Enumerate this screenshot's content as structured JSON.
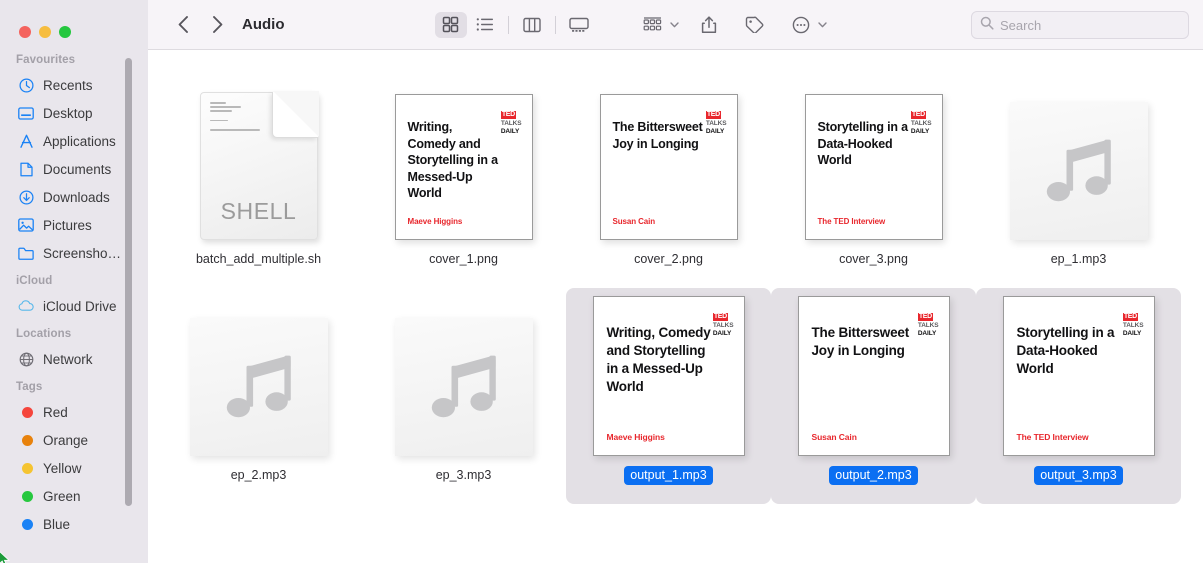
{
  "window": {
    "title": "Audio",
    "traffic_lights": [
      "close",
      "minimize",
      "zoom"
    ]
  },
  "toolbar": {
    "back_label": "Back",
    "forward_label": "Forward",
    "views": [
      {
        "name": "icon-view",
        "label": "Icon View",
        "active": true
      },
      {
        "name": "list-view",
        "label": "List View",
        "active": false
      },
      {
        "name": "column-view",
        "label": "Column View",
        "active": false
      },
      {
        "name": "gallery-view",
        "label": "Gallery View",
        "active": false
      }
    ],
    "group_label": "Group Items",
    "share_label": "Share",
    "tag_label": "Tags",
    "more_label": "More"
  },
  "search": {
    "placeholder": "Search",
    "value": ""
  },
  "sidebar": {
    "sections": [
      {
        "title": "Favourites",
        "items": [
          {
            "label": "Recents",
            "icon": "clock-icon"
          },
          {
            "label": "Desktop",
            "icon": "desktop-icon"
          },
          {
            "label": "Applications",
            "icon": "applications-icon"
          },
          {
            "label": "Documents",
            "icon": "document-icon"
          },
          {
            "label": "Downloads",
            "icon": "download-icon"
          },
          {
            "label": "Pictures",
            "icon": "pictures-icon"
          },
          {
            "label": "Screensho…",
            "icon": "folder-icon"
          }
        ]
      },
      {
        "title": "iCloud",
        "items": [
          {
            "label": "iCloud Drive",
            "icon": "cloud-icon"
          }
        ]
      },
      {
        "title": "Locations",
        "items": [
          {
            "label": "Network",
            "icon": "globe-icon"
          }
        ]
      },
      {
        "title": "Tags",
        "items": [
          {
            "label": "Red",
            "icon": "tag-dot",
            "color": "#f5453c"
          },
          {
            "label": "Orange",
            "icon": "tag-dot",
            "color": "#e8820c"
          },
          {
            "label": "Yellow",
            "icon": "tag-dot",
            "color": "#f5c game"
          },
          {
            "label": "Green",
            "icon": "tag-dot",
            "color": "#27c83f"
          },
          {
            "label": "Blue",
            "icon": "tag-dot",
            "color": "#1a82f5"
          }
        ]
      }
    ]
  },
  "files": [
    {
      "name": "batch_add_multiple.sh",
      "kind": "shell-script",
      "kind_label": "SHELL",
      "selected": false
    },
    {
      "name": "cover_1.png",
      "kind": "image-cover",
      "selected": false,
      "cover": {
        "title": "Writing, Comedy and Storytelling in a Messed-Up World",
        "author": "Maeve Higgins",
        "logo": {
          "line1": "TED",
          "line2": "TALKS",
          "line3": "DAILY"
        }
      }
    },
    {
      "name": "cover_2.png",
      "kind": "image-cover",
      "selected": false,
      "cover": {
        "title": "The Bittersweet Joy in Longing",
        "author": "Susan Cain",
        "logo": {
          "line1": "TED",
          "line2": "TALKS",
          "line3": "DAILY"
        }
      }
    },
    {
      "name": "cover_3.png",
      "kind": "image-cover",
      "selected": false,
      "cover": {
        "title": "Storytelling in a Data-Hooked World",
        "author": "The TED Interview",
        "logo": {
          "line1": "TED",
          "line2": "TALKS",
          "line3": "DAILY"
        }
      }
    },
    {
      "name": "ep_1.mp3",
      "kind": "audio",
      "selected": false
    },
    {
      "name": "ep_2.mp3",
      "kind": "audio",
      "selected": false
    },
    {
      "name": "ep_3.mp3",
      "kind": "audio",
      "selected": false
    },
    {
      "name": "output_1.mp3",
      "kind": "audio-cover",
      "selected": true,
      "cover": {
        "title": "Writing, Comedy and Storytelling in a Messed-Up World",
        "author": "Maeve Higgins",
        "logo": {
          "line1": "TED",
          "line2": "TALKS",
          "line3": "DAILY"
        }
      }
    },
    {
      "name": "output_2.mp3",
      "kind": "audio-cover",
      "selected": true,
      "cover": {
        "title": "The Bittersweet Joy in Longing",
        "author": "Susan Cain",
        "logo": {
          "line1": "TED",
          "line2": "TALKS",
          "line3": "DAILY"
        }
      }
    },
    {
      "name": "output_3.mp3",
      "kind": "audio-cover",
      "selected": true,
      "cover": {
        "title": "Storytelling in a Data-Hooked World",
        "author": "The TED Interview",
        "logo": {
          "line1": "TED",
          "line2": "TALKS",
          "line3": "DAILY"
        }
      }
    }
  ],
  "colors": {
    "selection_blue": "#0b6ff2",
    "selection_bg": "#e3e0e5",
    "accent_red": "#e8272d",
    "sidebar_bg": "#e9e6ec",
    "toolbar_bg": "#f7f4f8"
  }
}
